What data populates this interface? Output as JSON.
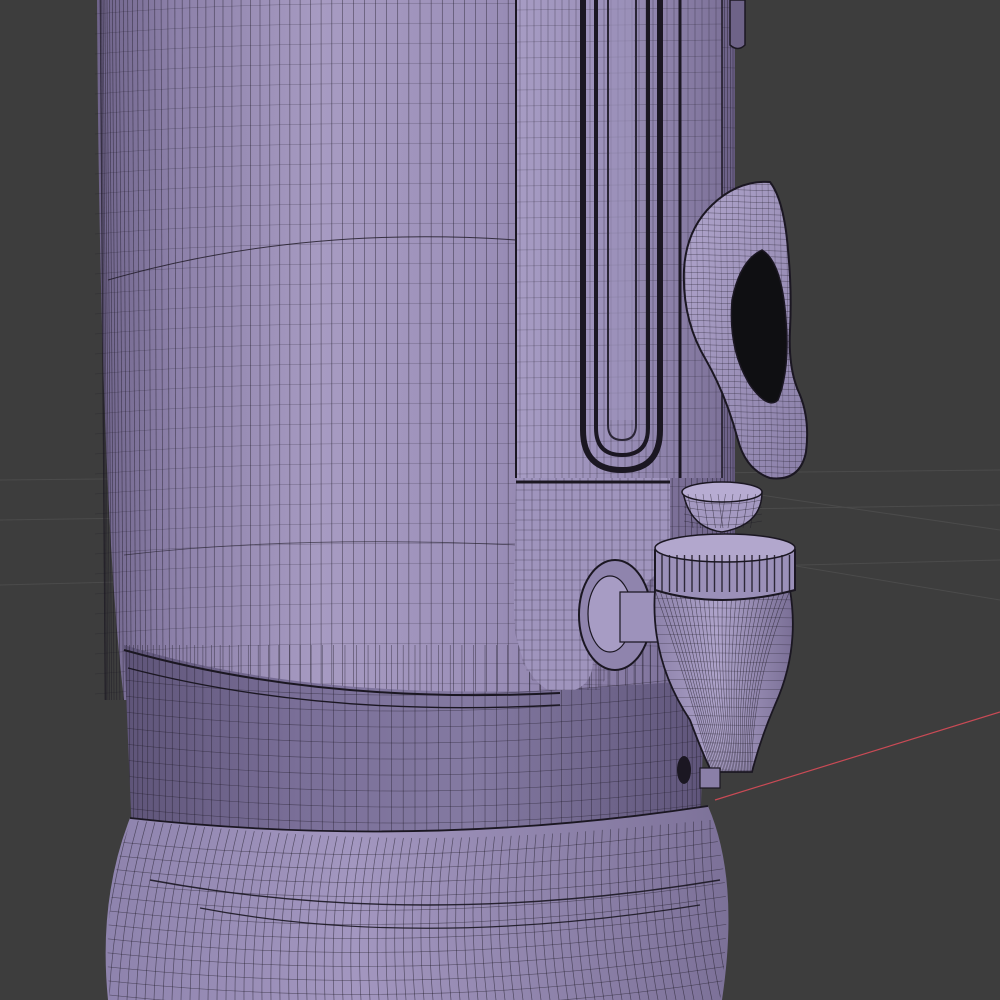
{
  "viewport": {
    "background_color": "#3d3d3d",
    "grid_color": "#4b4b4b",
    "x_axis_color": "#c94a55",
    "mesh_fill_color": "#9a8db5",
    "mesh_highlight_color": "#b3a7cc",
    "mesh_shadow_color": "#6d6387",
    "wire_color": "#1b1722",
    "cavity_color": "#0f0f12",
    "display_mode": "wireframe-overlay",
    "object": "water-urn-mesh",
    "parts": [
      "urn-body",
      "base-ring",
      "base-flare",
      "gauge-housing",
      "sight-glass",
      "tap-handle",
      "tap-cup",
      "tap-collar",
      "tap-valve-body",
      "tap-pipe"
    ]
  }
}
